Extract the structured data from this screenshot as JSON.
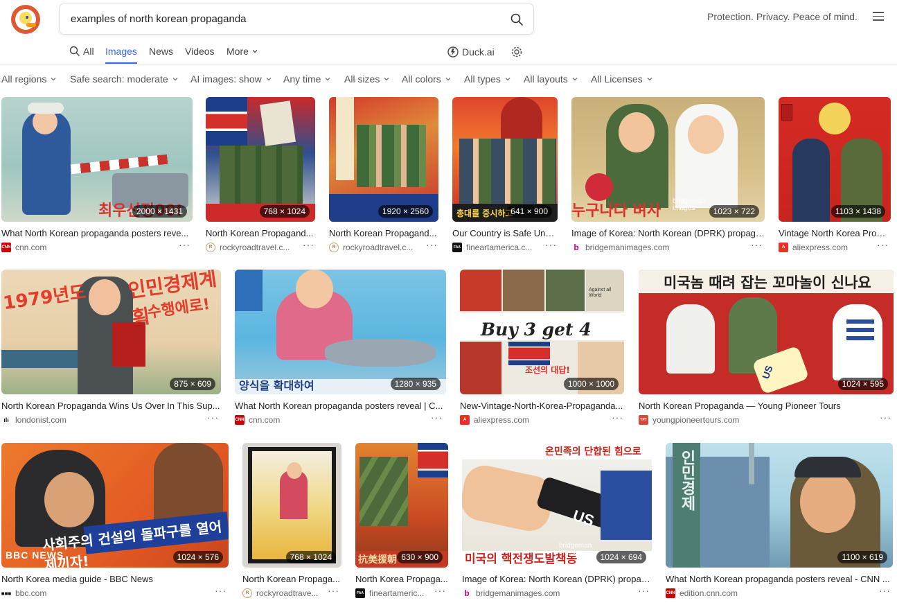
{
  "header": {
    "search_value": "examples of north korean propaganda",
    "tagline": "Protection. Privacy. Peace of mind."
  },
  "tabs": [
    {
      "label": "All",
      "icon": "search-icon"
    },
    {
      "label": "Images",
      "active": true
    },
    {
      "label": "News"
    },
    {
      "label": "Videos"
    },
    {
      "label": "More",
      "icon": "chevron-down-icon"
    }
  ],
  "duck_ai_label": "Duck.ai",
  "filters": [
    "All regions",
    "Safe search: moderate",
    "AI images: show",
    "Any time",
    "All sizes",
    "All colors",
    "All types",
    "All layouts",
    "All Licenses"
  ],
  "results": [
    {
      "caption": "What North Korean propaganda posters reve...",
      "source": "cnn.com",
      "dims": "2000 × 1431",
      "fav": "cnn"
    },
    {
      "caption": "North Korean Propagand...",
      "source": "rockyroadtravel.c...",
      "dims": "768 × 1024",
      "fav": "rocky"
    },
    {
      "caption": "North Korean Propagand...",
      "source": "rockyroadtravel.c...",
      "dims": "1920 × 2560",
      "fav": "rocky"
    },
    {
      "caption": "Our Country is Safe Und...",
      "source": "fineartamerica.c...",
      "dims": "641 × 900",
      "fav": "faa"
    },
    {
      "caption": "Image of Korea: North Korean (DPRK) propaga...",
      "source": "bridgemanimages.com",
      "dims": "1023 × 722",
      "fav": "bridgeman"
    },
    {
      "caption": "Vintage North Korea Prop...",
      "source": "aliexpress.com",
      "dims": "1103 × 1438",
      "fav": "ali"
    },
    {
      "caption": "North Korean Propaganda Wins Us Over In This Sup...",
      "source": "londonist.com",
      "dims": "875 × 609",
      "fav": "londonist"
    },
    {
      "caption": "What North Korean propaganda posters reveal | C...",
      "source": "cnn.com",
      "dims": "1280 × 935",
      "fav": "cnn"
    },
    {
      "caption": "New-Vintage-North-Korea-Propaganda...",
      "source": "aliexpress.com",
      "dims": "1000 × 1000",
      "fav": "ali"
    },
    {
      "caption": "North Korean Propaganda — Young Pioneer Tours",
      "source": "youngpioneertours.com",
      "dims": "1024 × 595",
      "fav": "ypt"
    },
    {
      "caption": "North Korea media guide - BBC News",
      "source": "bbc.com",
      "dims": "1024 × 576",
      "fav": "bbc"
    },
    {
      "caption": "North Korean Propaga...",
      "source": "rockyroadtrave...",
      "dims": "768 × 1024",
      "fav": "rocky"
    },
    {
      "caption": "North Korea Propaga...",
      "source": "fineartameric...",
      "dims": "630 × 900",
      "fav": "faa"
    },
    {
      "caption": "Image of Korea: North Korean (DPRK) propag...",
      "source": "bridgemanimages.com",
      "dims": "1024 × 694",
      "fav": "bridgeman"
    },
    {
      "caption": "What North Korean propaganda posters reveal - CNN ...",
      "source": "edition.cnn.com",
      "dims": "1100 × 619",
      "fav": "cnn"
    }
  ],
  "overlay_text": {
    "r1c1": "최우선정00!",
    "r1c4": "총대를 중시하고",
    "r1c5": "누구나다 벼사",
    "r2c1_year": "1979년도",
    "r2c1_main": "인민경제계획",
    "r2c1_sub": "수행에로!",
    "r2c2": "양식을 확대하여",
    "r2c3_main": "Buy 3 get 4",
    "r2c3_small": "Against all World",
    "r2c3_kor": "조선의 대답!",
    "r2c4": "미국놈 때려 잡는 꼬마놀이 신나요",
    "r2c4_us": "US",
    "r3c1": "사회주의 건설의 돌파구를 열어제끼자!",
    "r3c1_brand": "BBC NEWS",
    "r3c3": "抗美援朝",
    "r3c4_top": "온민족의 단합된 힘으로",
    "r3c4_us": "US",
    "r3c4_bottom": "미국의 핵전쟁도발책동",
    "r3c5": "인민경제",
    "watermark": "bridgeman images"
  }
}
